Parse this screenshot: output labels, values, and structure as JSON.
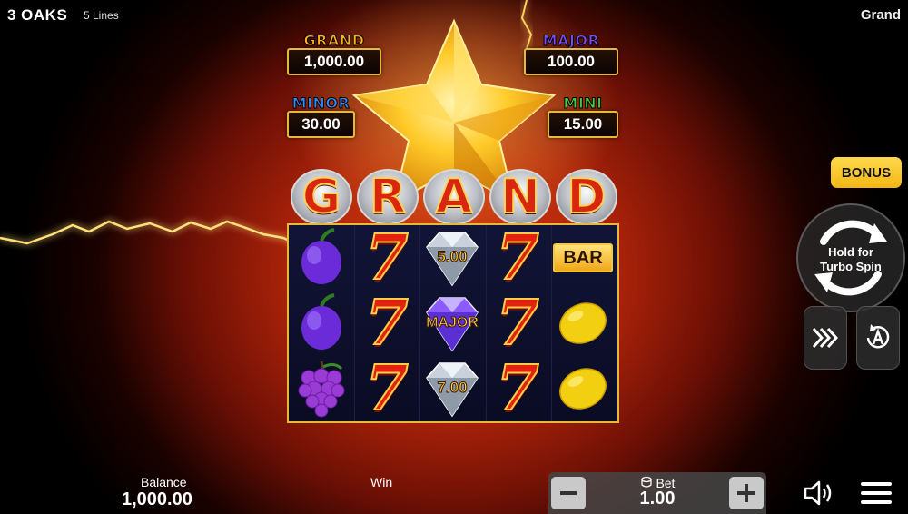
{
  "header": {
    "game_title": "3 OAKS",
    "lines_label": "5 Lines",
    "current_game": "Grand"
  },
  "jackpots": {
    "grand": {
      "label": "GRAND",
      "value": "1,000.00"
    },
    "major": {
      "label": "MAJOR",
      "value": "100.00"
    },
    "minor": {
      "label": "MINOR",
      "value": "30.00"
    },
    "mini": {
      "label": "MINI",
      "value": "15.00"
    }
  },
  "grand_letters": [
    "G",
    "R",
    "A",
    "N",
    "D"
  ],
  "reels": {
    "grid": [
      [
        "plum",
        "seven",
        "diamond",
        "seven",
        "bar"
      ],
      [
        "plum",
        "seven",
        "diamond-major",
        "seven",
        "lemon"
      ],
      [
        "grapes",
        "seven",
        "diamond",
        "seven",
        "lemon"
      ]
    ],
    "symbol_texts": {
      "bar": "BAR",
      "seven": "7",
      "diamond_row1": "5.00",
      "diamond_row2": "MAJOR",
      "diamond_row3": "7.00"
    }
  },
  "controls": {
    "bonus_label": "BONUS",
    "spin_line1": "Hold for",
    "spin_line2": "Turbo Spin",
    "turbo_icon": "fast-forward-icon",
    "auto_icon": "autoplay-icon"
  },
  "footer": {
    "balance_label": "Balance",
    "balance_value": "1,000.00",
    "win_label": "Win",
    "bet_label": "Bet",
    "bet_value": "1.00",
    "minus_icon": "minus-icon",
    "plus_icon": "plus-icon",
    "sound_icon": "speaker-icon",
    "menu_icon": "hamburger-menu-icon"
  },
  "colors": {
    "gold_border": "#e7b93a",
    "grand_label": "#ffb21c",
    "major_label": "#7b4bff",
    "minor_label": "#2f8bff",
    "mini_label": "#3fd03a",
    "bonus_bg": "#f2b615",
    "seven_red": "#e2220f"
  }
}
